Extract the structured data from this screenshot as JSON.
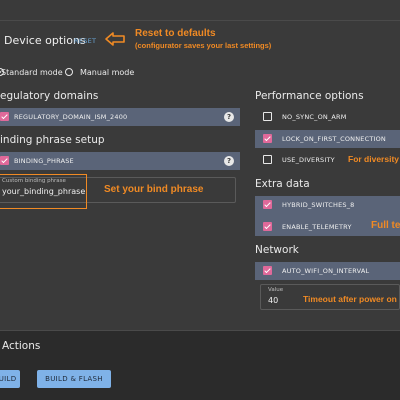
{
  "header": {
    "title": "Device options",
    "reset_label": "RESET",
    "reset_annotation_line1": "Reset to defaults",
    "reset_annotation_line2": "(configurator saves your last settings)"
  },
  "mode": {
    "standard_label": "Standard mode",
    "manual_label": "Manual mode",
    "selected": "Standard mode"
  },
  "regulatory": {
    "heading": "egulatory domains",
    "item": "REGULATORY_DOMAIN_ISM_2400",
    "checked": true
  },
  "binding": {
    "heading": "inding phrase setup",
    "item": "BINDING_PHRASE",
    "checked": true,
    "field_label": "Custom binding phrase",
    "field_value": "your_binding_phrase",
    "annotation": "Set your bind phrase"
  },
  "performance": {
    "heading": "Performance options",
    "items": [
      {
        "label": "NO_SYNC_ON_ARM",
        "checked": false
      },
      {
        "label": "LOCK_ON_FIRST_CONNECTION",
        "checked": true
      },
      {
        "label": "USE_DIVERSITY",
        "checked": false
      }
    ],
    "diversity_annotation": "For diversity"
  },
  "extra": {
    "heading": "Extra data",
    "items": [
      {
        "label": "HYBRID_SWITCHES_8",
        "checked": true
      },
      {
        "label": "ENABLE_TELEMETRY",
        "checked": true
      }
    ],
    "telemetry_annotation": "Full te"
  },
  "network": {
    "heading": "Network",
    "item": "AUTO_WIFI_ON_INTERVAL",
    "checked": true,
    "value_label": "Value",
    "value": "40",
    "annotation": "Timeout after power on"
  },
  "actions": {
    "heading": "Actions",
    "build_label": "BUILD",
    "build_flash_label": "BUILD & FLASH"
  },
  "colors": {
    "accent_orange": "#f08a24",
    "checkbox_pink": "#e0699a",
    "selected_row": "#5a6478",
    "button_blue": "#7fb2e8",
    "reset_blue": "#6aa6d8"
  }
}
